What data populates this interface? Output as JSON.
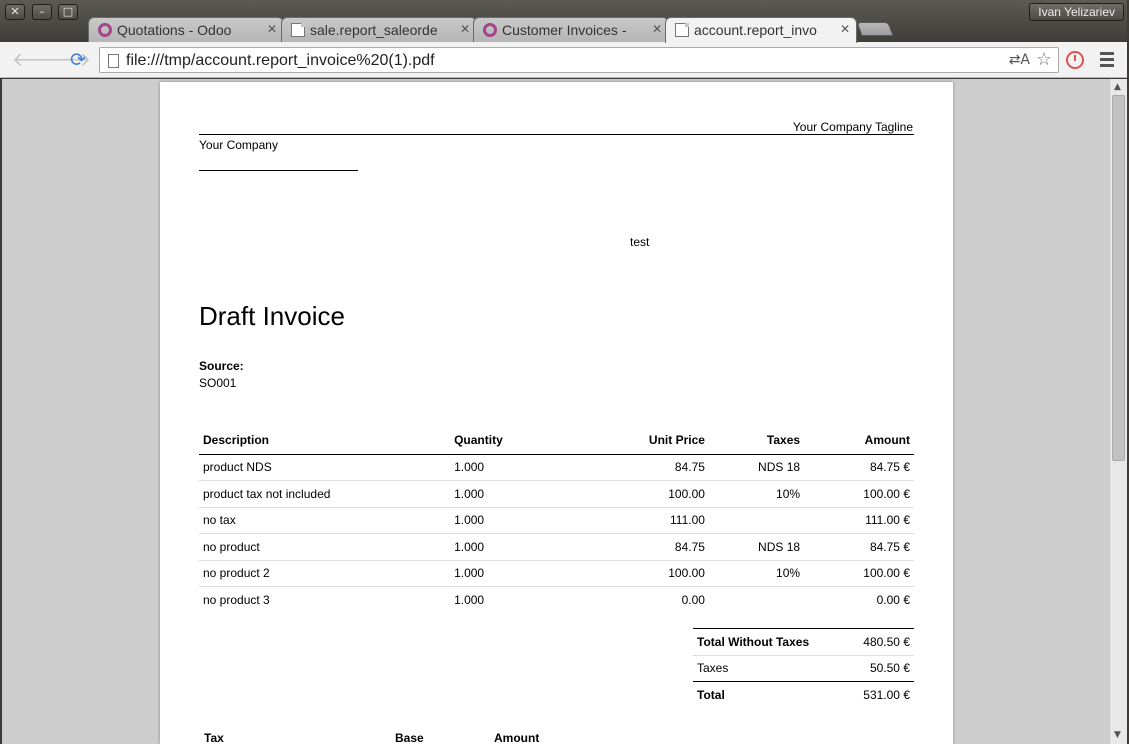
{
  "window": {
    "user_name": "Ivan Yelizariev"
  },
  "tabs": [
    {
      "title": "Quotations - Odoo",
      "icon": "odoo-icon",
      "active": false
    },
    {
      "title": "sale.report_saleorde",
      "icon": "document-icon",
      "active": false
    },
    {
      "title": "Customer Invoices -",
      "icon": "odoo-icon",
      "active": false
    },
    {
      "title": "account.report_invo",
      "icon": "document-icon",
      "active": true
    }
  ],
  "toolbar": {
    "url": "file:///tmp/account.report_invoice%20(1).pdf"
  },
  "invoice": {
    "tagline": "Your Company Tagline",
    "company_name": "Your Company",
    "partner_name": "test",
    "title": "Draft Invoice",
    "source_label": "Source:",
    "source_value": "SO001",
    "columns": {
      "description": "Description",
      "quantity": "Quantity",
      "unit_price": "Unit Price",
      "taxes": "Taxes",
      "amount": "Amount"
    },
    "lines": [
      {
        "description": "product NDS",
        "quantity": "1.000",
        "unit_price": "84.75",
        "taxes": "NDS 18",
        "amount": "84.75 €"
      },
      {
        "description": "product tax not included",
        "quantity": "1.000",
        "unit_price": "100.00",
        "taxes": "10%",
        "amount": "100.00 €"
      },
      {
        "description": "no tax",
        "quantity": "1.000",
        "unit_price": "111.00",
        "taxes": "",
        "amount": "111.00 €"
      },
      {
        "description": "no product",
        "quantity": "1.000",
        "unit_price": "84.75",
        "taxes": "NDS 18",
        "amount": "84.75 €"
      },
      {
        "description": "no product 2",
        "quantity": "1.000",
        "unit_price": "100.00",
        "taxes": "10%",
        "amount": "100.00 €"
      },
      {
        "description": "no product 3",
        "quantity": "1.000",
        "unit_price": "0.00",
        "taxes": "",
        "amount": "0.00 €"
      }
    ],
    "totals": {
      "untaxed_label": "Total Without Taxes",
      "untaxed_value": "480.50 €",
      "taxes_label": "Taxes",
      "taxes_value": "50.50 €",
      "total_label": "Total",
      "total_value": "531.00 €"
    },
    "tax_table_columns": {
      "tax": "Tax",
      "base": "Base",
      "amount": "Amount"
    }
  }
}
